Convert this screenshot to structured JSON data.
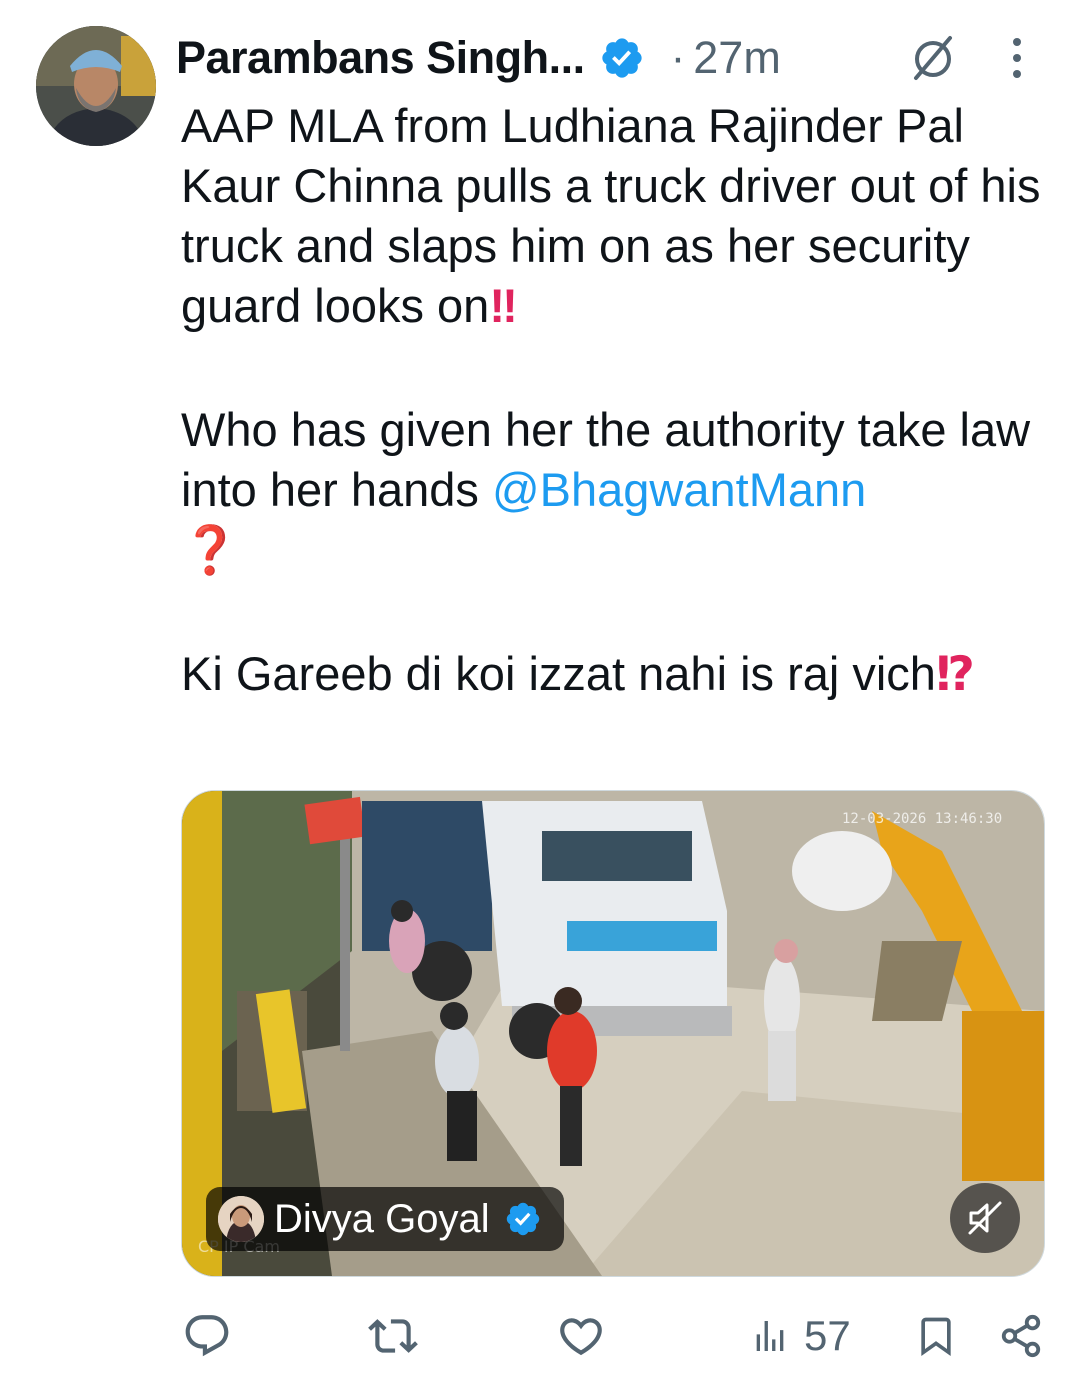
{
  "author": {
    "name": "Parambans Singh...",
    "avatar_icon": "profile-photo",
    "verified_icon": "verified-badge-icon",
    "separator": "·",
    "time": "27m"
  },
  "tweet": {
    "paragraphs": [
      {
        "text": "AAP MLA from Ludhiana Rajinder Pal Kaur Chinna pulls a truck driver out of his truck and slaps him on as her security guard looks on",
        "emoji": "‼"
      },
      {
        "text": "Who has given her the authority take law into her hands ",
        "mention": "@BhagwantMann",
        "emoji": "❓"
      },
      {
        "text": "Ki Gareeb di koi izzat nahi is raj vich",
        "emoji": "⁉"
      }
    ]
  },
  "media": {
    "camera_timestamp": "12-03-2026 13:46:30",
    "camera_label": "CP IP Cam",
    "credit_name": "Divya Goyal",
    "mute_icon": "speaker-muted-icon"
  },
  "actions": {
    "reply_icon": "reply-icon",
    "repost_icon": "repost-icon",
    "like_icon": "heart-icon",
    "views_icon": "views-chart-icon",
    "views_count": "57",
    "bookmark_icon": "bookmark-icon",
    "share_icon": "share-icon"
  },
  "colors": {
    "text": "#0f1419",
    "secondary": "#536471",
    "link": "#1d9bf0",
    "verified": "#1d9bf0",
    "emoji_red": "#e0245e"
  }
}
